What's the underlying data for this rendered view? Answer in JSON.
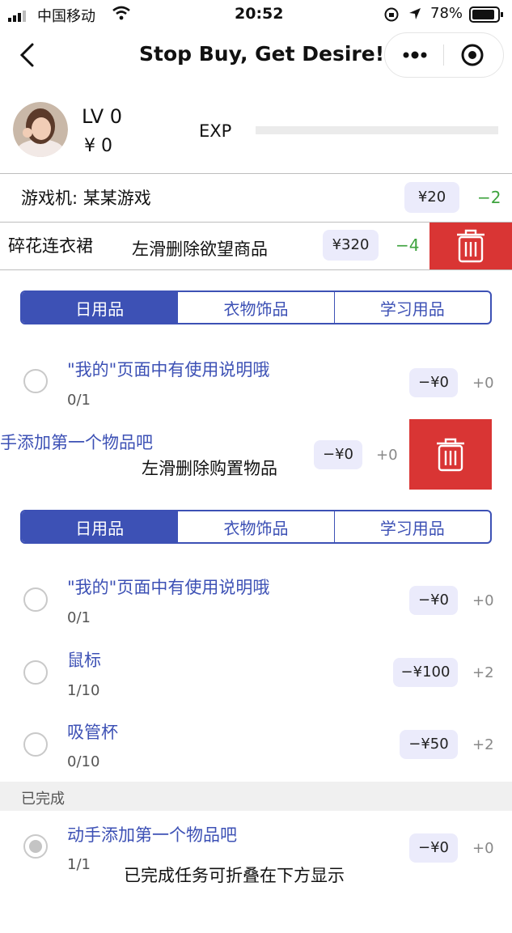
{
  "status_bar": {
    "carrier": "中国移动",
    "time": "20:52",
    "battery": "78%"
  },
  "nav": {
    "title": "Stop Buy, Get Desire!"
  },
  "profile": {
    "level": "LV 0",
    "money": "¥ 0",
    "exp_label": "EXP",
    "exp_progress": 0
  },
  "desires": [
    {
      "name": "游戏机: 某某游戏",
      "price": "¥20",
      "points": "−2"
    },
    {
      "name": "碎花连衣裙",
      "price": "¥320",
      "points": "−4"
    }
  ],
  "hints": {
    "swipe_desire": "左滑删除欲望商品",
    "swipe_item": "左滑删除购置物品",
    "collapsed": "已完成任务可折叠在下方显示"
  },
  "tabs": [
    "日用品",
    "衣物饰品",
    "学习用品"
  ],
  "section1": {
    "items": [
      {
        "title": "\"我的\"页面中有使用说明哦",
        "progress": "0/1",
        "price": "−¥0",
        "points": "+0"
      },
      {
        "title": "手添加第一个物品吧",
        "price": "−¥0",
        "points": "+0"
      }
    ]
  },
  "section2": {
    "items": [
      {
        "title": "\"我的\"页面中有使用说明哦",
        "progress": "0/1",
        "price": "−¥0",
        "points": "+0"
      },
      {
        "title": "鼠标",
        "progress": "1/10",
        "price": "−¥100",
        "points": "+2"
      },
      {
        "title": "吸管杯",
        "progress": "0/10",
        "price": "−¥50",
        "points": "+2"
      }
    ],
    "completed_label": "已完成",
    "completed": [
      {
        "title": "动手添加第一个物品吧",
        "progress": "1/1",
        "price": "−¥0",
        "points": "+0"
      }
    ]
  },
  "colors": {
    "accent": "#3d51b5",
    "danger": "#d93534",
    "green": "#3ea33e",
    "pill": "#ebebfb"
  },
  "icons": [
    "signal-icon",
    "wifi-icon",
    "lock-rotation-icon",
    "location-arrow-icon",
    "battery-icon",
    "back-chevron-icon",
    "more-icon",
    "close-target-icon",
    "trash-icon"
  ]
}
